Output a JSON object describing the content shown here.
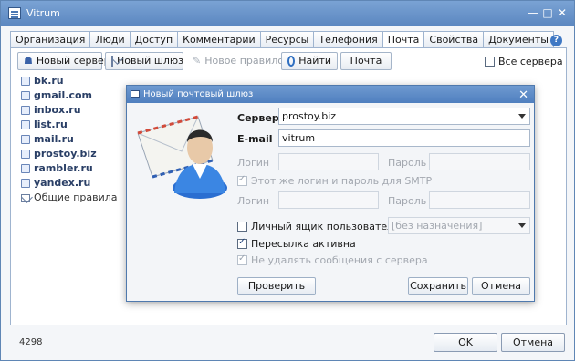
{
  "window": {
    "title": "Vitrum",
    "minimize": "—",
    "maximize": "□",
    "close": "✕"
  },
  "tabs": [
    {
      "label": "Организация"
    },
    {
      "label": "Люди"
    },
    {
      "label": "Доступ"
    },
    {
      "label": "Комментарии"
    },
    {
      "label": "Ресурсы"
    },
    {
      "label": "Телефония"
    },
    {
      "label": "Почта",
      "active": true
    },
    {
      "label": "Свойства"
    },
    {
      "label": "Документы"
    }
  ],
  "help": "?",
  "toolbar": {
    "new_server": "Новый сервер",
    "new_gateway": "Новый шлюз",
    "new_rule": "Новое правило",
    "find": "Найти",
    "mail": "Почта",
    "all_servers": "Все сервера"
  },
  "servers": [
    {
      "label": "bk.ru"
    },
    {
      "label": "gmail.com"
    },
    {
      "label": "inbox.ru"
    },
    {
      "label": "list.ru"
    },
    {
      "label": "mail.ru"
    },
    {
      "label": "prostoy.biz"
    },
    {
      "label": "rambler.ru"
    },
    {
      "label": "yandex.ru"
    },
    {
      "label": "Общие правила"
    }
  ],
  "status": "4298",
  "footer": {
    "ok": "OK",
    "cancel": "Отмена"
  },
  "dialog": {
    "title": "Новый почтовый шлюз",
    "close": "✕",
    "server_label": "Сервер",
    "server_value": "prostoy.biz",
    "email_label": "E-mail",
    "email_value": "vitrum",
    "login_label": "Логин",
    "password_label": "Пароль",
    "smtp_same_label": "Этот же логин и пароль для SMTP",
    "smtp_login_label": "Логин",
    "smtp_password_label": "Пароль",
    "personal_box_label": "Личный ящик пользователя",
    "personal_box_value": "[без назначения]",
    "forwarding_label": "Пересылка активна",
    "keep_messages_label": "Не удалять сообщения с сервера",
    "check": "Проверить",
    "save": "Сохранить",
    "cancel": "Отмена"
  },
  "colors": {
    "titlebar": "#5b87c0",
    "accent": "#2f6fc1",
    "panel_border": "#9fb4cf"
  }
}
